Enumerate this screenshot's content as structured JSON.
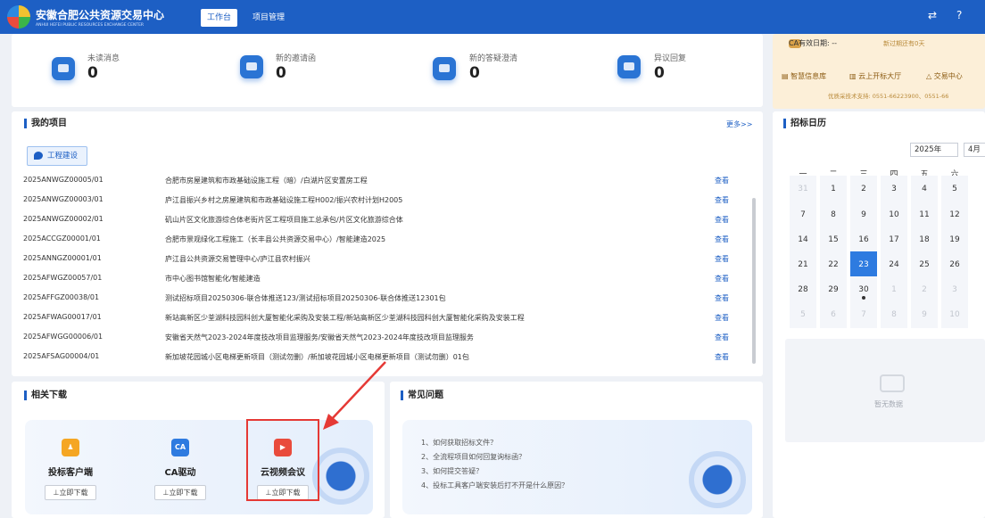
{
  "header": {
    "logo_title": "安徽合肥公共资源交易中心",
    "logo_subtitle": "ANHUI HEFEI PUBLIC RESOURCES EXCHANGE CENTER",
    "tabs": [
      "工作台",
      "项目管理"
    ],
    "active_tab": "工作台",
    "icons": [
      "switch-icon",
      "help-icon"
    ]
  },
  "stats": [
    {
      "label": "未读消息",
      "value": "0",
      "icon": "message-icon"
    },
    {
      "label": "新的邀请函",
      "value": "0",
      "icon": "invitation-icon"
    },
    {
      "label": "新的答疑澄清",
      "value": "0",
      "icon": "qa-icon"
    },
    {
      "label": "异议回复",
      "value": "0",
      "icon": "objection-icon"
    }
  ],
  "ca": {
    "expiry_label": "CA有效日期: --",
    "expiry_note": "新过期还有0天",
    "links": [
      "智慧信息库",
      "云上开标大厅",
      "交易中心"
    ],
    "support": "优质采技术支持: 0551-66223900、0551-66"
  },
  "projects": {
    "title": "我的项目",
    "more": "更多>>",
    "tag": "工程建设",
    "view_label": "查看",
    "rows": [
      {
        "code": "2025ANWGZ00005/01",
        "name": "合肥市房屋建筑和市政基础设施工程（暗）/白湖片区安置房工程"
      },
      {
        "code": "2025ANWGZ00003/01",
        "name": "庐江县振兴乡村之房屋建筑和市政基础设施工程H002/振兴农村计划H2005"
      },
      {
        "code": "2025ANWGZ00002/01",
        "name": "矶山片区文化旅游综合体老街片区工程项目施工总承包/片区文化旅游综合体"
      },
      {
        "code": "2025ACCGZ00001/01",
        "name": "合肥市景观绿化工程施工（长丰县公共资源交易中心）/智能建造2025"
      },
      {
        "code": "2025ANNGZ00001/01",
        "name": "庐江县公共资源交易管理中心/庐江县农村振兴"
      },
      {
        "code": "2025AFWGZ00057/01",
        "name": "市中心图书馆智能化/智能建造"
      },
      {
        "code": "2025AFFGZ00038/01",
        "name": "测试招标项目20250306-联合体推送123/测试招标项目20250306-联合体推送12301包"
      },
      {
        "code": "2025AFWAG00017/01",
        "name": "新站高新区少荃湖科技园科创大厦智能化采购及安装工程/新站高新区少荃湖科技园科创大厦智能化采购及安装工程"
      },
      {
        "code": "2025AFWGG00006/01",
        "name": "安徽省天然气2023-2024年度技改项目监理服务/安徽省天然气2023-2024年度技改项目监理服务"
      },
      {
        "code": "2025AFSAG00004/01",
        "name": "新加坡花园城小区电梯更新项目（测试勿删）/新加坡花园城小区电梯更新项目（测试勿删）01包"
      }
    ]
  },
  "downloads": {
    "title": "相关下载",
    "items": [
      {
        "name": "投标客户端",
        "icon_text": "",
        "color": "#f5a623"
      },
      {
        "name": "CA驱动",
        "icon_text": "CA",
        "color": "#2e7be0"
      },
      {
        "name": "云视频会议",
        "icon_text": "",
        "color": "#e94b3c"
      }
    ],
    "button_label": "⊥立即下载"
  },
  "faq": {
    "title": "常见问题",
    "items": [
      "1、如何获取招标文件？",
      "2、全流程项目如何回复询标函？",
      "3、如何提交答疑？",
      "4、投标工具客户端安装后打不开是什么原因？"
    ]
  },
  "calendar": {
    "title": "招标日历",
    "year": "2025年",
    "month": "4月",
    "weekdays": [
      "一",
      "二",
      "三",
      "四",
      "五",
      "六"
    ],
    "weeks": [
      [
        "31",
        "1",
        "2",
        "3",
        "4",
        "5"
      ],
      [
        "7",
        "8",
        "9",
        "10",
        "11",
        "12"
      ],
      [
        "14",
        "15",
        "16",
        "17",
        "18",
        "19"
      ],
      [
        "21",
        "22",
        "23",
        "24",
        "25",
        "26"
      ],
      [
        "28",
        "29",
        "30",
        "1",
        "2",
        "3"
      ],
      [
        "5",
        "6",
        "7",
        "8",
        "9",
        "10"
      ]
    ],
    "today": "23",
    "empty_text": "暂无数据"
  },
  "colors": {
    "brand": "#1d5fc4",
    "today": "#2e7be0",
    "highlight": "#e53935"
  }
}
